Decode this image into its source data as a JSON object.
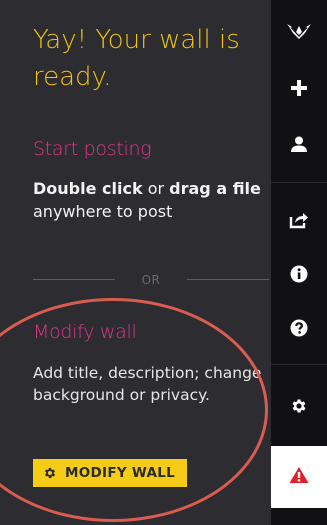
{
  "panel": {
    "title": "Yay! Your wall is ready.",
    "start_heading": "Start posting",
    "post_help": {
      "bold1": "Double click",
      "text1": " or ",
      "bold2": "drag a file",
      "text2": " anywhere to post"
    },
    "divider_label": "OR",
    "modify_heading": "Modify wall",
    "modify_help": "Add title, description; change background or privacy.",
    "modify_button_label": "MODIFY WALL"
  },
  "toolbar": {
    "items": [
      {
        "name": "logo-icon"
      },
      {
        "name": "plus-icon"
      },
      {
        "name": "user-icon"
      },
      {
        "name": "share-icon"
      },
      {
        "name": "info-icon"
      },
      {
        "name": "help-icon"
      },
      {
        "name": "gear-icon"
      },
      {
        "name": "warning-icon"
      }
    ]
  },
  "colors": {
    "panel_bg": "#2c2c31",
    "toolbar_bg": "#111114",
    "title": "#f2c30f",
    "heading": "#e0388a",
    "button_bg": "#f7cc17",
    "highlight_ring": "#d95c50",
    "warning": "#e0202a"
  }
}
